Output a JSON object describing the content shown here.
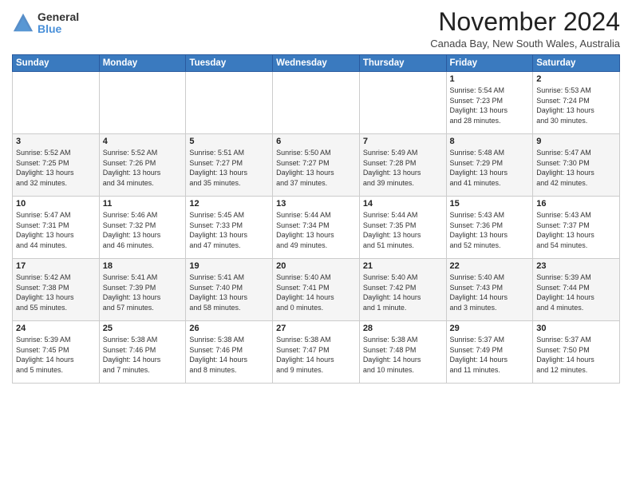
{
  "logo": {
    "general": "General",
    "blue": "Blue"
  },
  "header": {
    "month": "November 2024",
    "location": "Canada Bay, New South Wales, Australia"
  },
  "weekdays": [
    "Sunday",
    "Monday",
    "Tuesday",
    "Wednesday",
    "Thursday",
    "Friday",
    "Saturday"
  ],
  "weeks": [
    [
      {
        "day": "",
        "info": ""
      },
      {
        "day": "",
        "info": ""
      },
      {
        "day": "",
        "info": ""
      },
      {
        "day": "",
        "info": ""
      },
      {
        "day": "",
        "info": ""
      },
      {
        "day": "1",
        "info": "Sunrise: 5:54 AM\nSunset: 7:23 PM\nDaylight: 13 hours\nand 28 minutes."
      },
      {
        "day": "2",
        "info": "Sunrise: 5:53 AM\nSunset: 7:24 PM\nDaylight: 13 hours\nand 30 minutes."
      }
    ],
    [
      {
        "day": "3",
        "info": "Sunrise: 5:52 AM\nSunset: 7:25 PM\nDaylight: 13 hours\nand 32 minutes."
      },
      {
        "day": "4",
        "info": "Sunrise: 5:52 AM\nSunset: 7:26 PM\nDaylight: 13 hours\nand 34 minutes."
      },
      {
        "day": "5",
        "info": "Sunrise: 5:51 AM\nSunset: 7:27 PM\nDaylight: 13 hours\nand 35 minutes."
      },
      {
        "day": "6",
        "info": "Sunrise: 5:50 AM\nSunset: 7:27 PM\nDaylight: 13 hours\nand 37 minutes."
      },
      {
        "day": "7",
        "info": "Sunrise: 5:49 AM\nSunset: 7:28 PM\nDaylight: 13 hours\nand 39 minutes."
      },
      {
        "day": "8",
        "info": "Sunrise: 5:48 AM\nSunset: 7:29 PM\nDaylight: 13 hours\nand 41 minutes."
      },
      {
        "day": "9",
        "info": "Sunrise: 5:47 AM\nSunset: 7:30 PM\nDaylight: 13 hours\nand 42 minutes."
      }
    ],
    [
      {
        "day": "10",
        "info": "Sunrise: 5:47 AM\nSunset: 7:31 PM\nDaylight: 13 hours\nand 44 minutes."
      },
      {
        "day": "11",
        "info": "Sunrise: 5:46 AM\nSunset: 7:32 PM\nDaylight: 13 hours\nand 46 minutes."
      },
      {
        "day": "12",
        "info": "Sunrise: 5:45 AM\nSunset: 7:33 PM\nDaylight: 13 hours\nand 47 minutes."
      },
      {
        "day": "13",
        "info": "Sunrise: 5:44 AM\nSunset: 7:34 PM\nDaylight: 13 hours\nand 49 minutes."
      },
      {
        "day": "14",
        "info": "Sunrise: 5:44 AM\nSunset: 7:35 PM\nDaylight: 13 hours\nand 51 minutes."
      },
      {
        "day": "15",
        "info": "Sunrise: 5:43 AM\nSunset: 7:36 PM\nDaylight: 13 hours\nand 52 minutes."
      },
      {
        "day": "16",
        "info": "Sunrise: 5:43 AM\nSunset: 7:37 PM\nDaylight: 13 hours\nand 54 minutes."
      }
    ],
    [
      {
        "day": "17",
        "info": "Sunrise: 5:42 AM\nSunset: 7:38 PM\nDaylight: 13 hours\nand 55 minutes."
      },
      {
        "day": "18",
        "info": "Sunrise: 5:41 AM\nSunset: 7:39 PM\nDaylight: 13 hours\nand 57 minutes."
      },
      {
        "day": "19",
        "info": "Sunrise: 5:41 AM\nSunset: 7:40 PM\nDaylight: 13 hours\nand 58 minutes."
      },
      {
        "day": "20",
        "info": "Sunrise: 5:40 AM\nSunset: 7:41 PM\nDaylight: 14 hours\nand 0 minutes."
      },
      {
        "day": "21",
        "info": "Sunrise: 5:40 AM\nSunset: 7:42 PM\nDaylight: 14 hours\nand 1 minute."
      },
      {
        "day": "22",
        "info": "Sunrise: 5:40 AM\nSunset: 7:43 PM\nDaylight: 14 hours\nand 3 minutes."
      },
      {
        "day": "23",
        "info": "Sunrise: 5:39 AM\nSunset: 7:44 PM\nDaylight: 14 hours\nand 4 minutes."
      }
    ],
    [
      {
        "day": "24",
        "info": "Sunrise: 5:39 AM\nSunset: 7:45 PM\nDaylight: 14 hours\nand 5 minutes."
      },
      {
        "day": "25",
        "info": "Sunrise: 5:38 AM\nSunset: 7:46 PM\nDaylight: 14 hours\nand 7 minutes."
      },
      {
        "day": "26",
        "info": "Sunrise: 5:38 AM\nSunset: 7:46 PM\nDaylight: 14 hours\nand 8 minutes."
      },
      {
        "day": "27",
        "info": "Sunrise: 5:38 AM\nSunset: 7:47 PM\nDaylight: 14 hours\nand 9 minutes."
      },
      {
        "day": "28",
        "info": "Sunrise: 5:38 AM\nSunset: 7:48 PM\nDaylight: 14 hours\nand 10 minutes."
      },
      {
        "day": "29",
        "info": "Sunrise: 5:37 AM\nSunset: 7:49 PM\nDaylight: 14 hours\nand 11 minutes."
      },
      {
        "day": "30",
        "info": "Sunrise: 5:37 AM\nSunset: 7:50 PM\nDaylight: 14 hours\nand 12 minutes."
      }
    ]
  ]
}
